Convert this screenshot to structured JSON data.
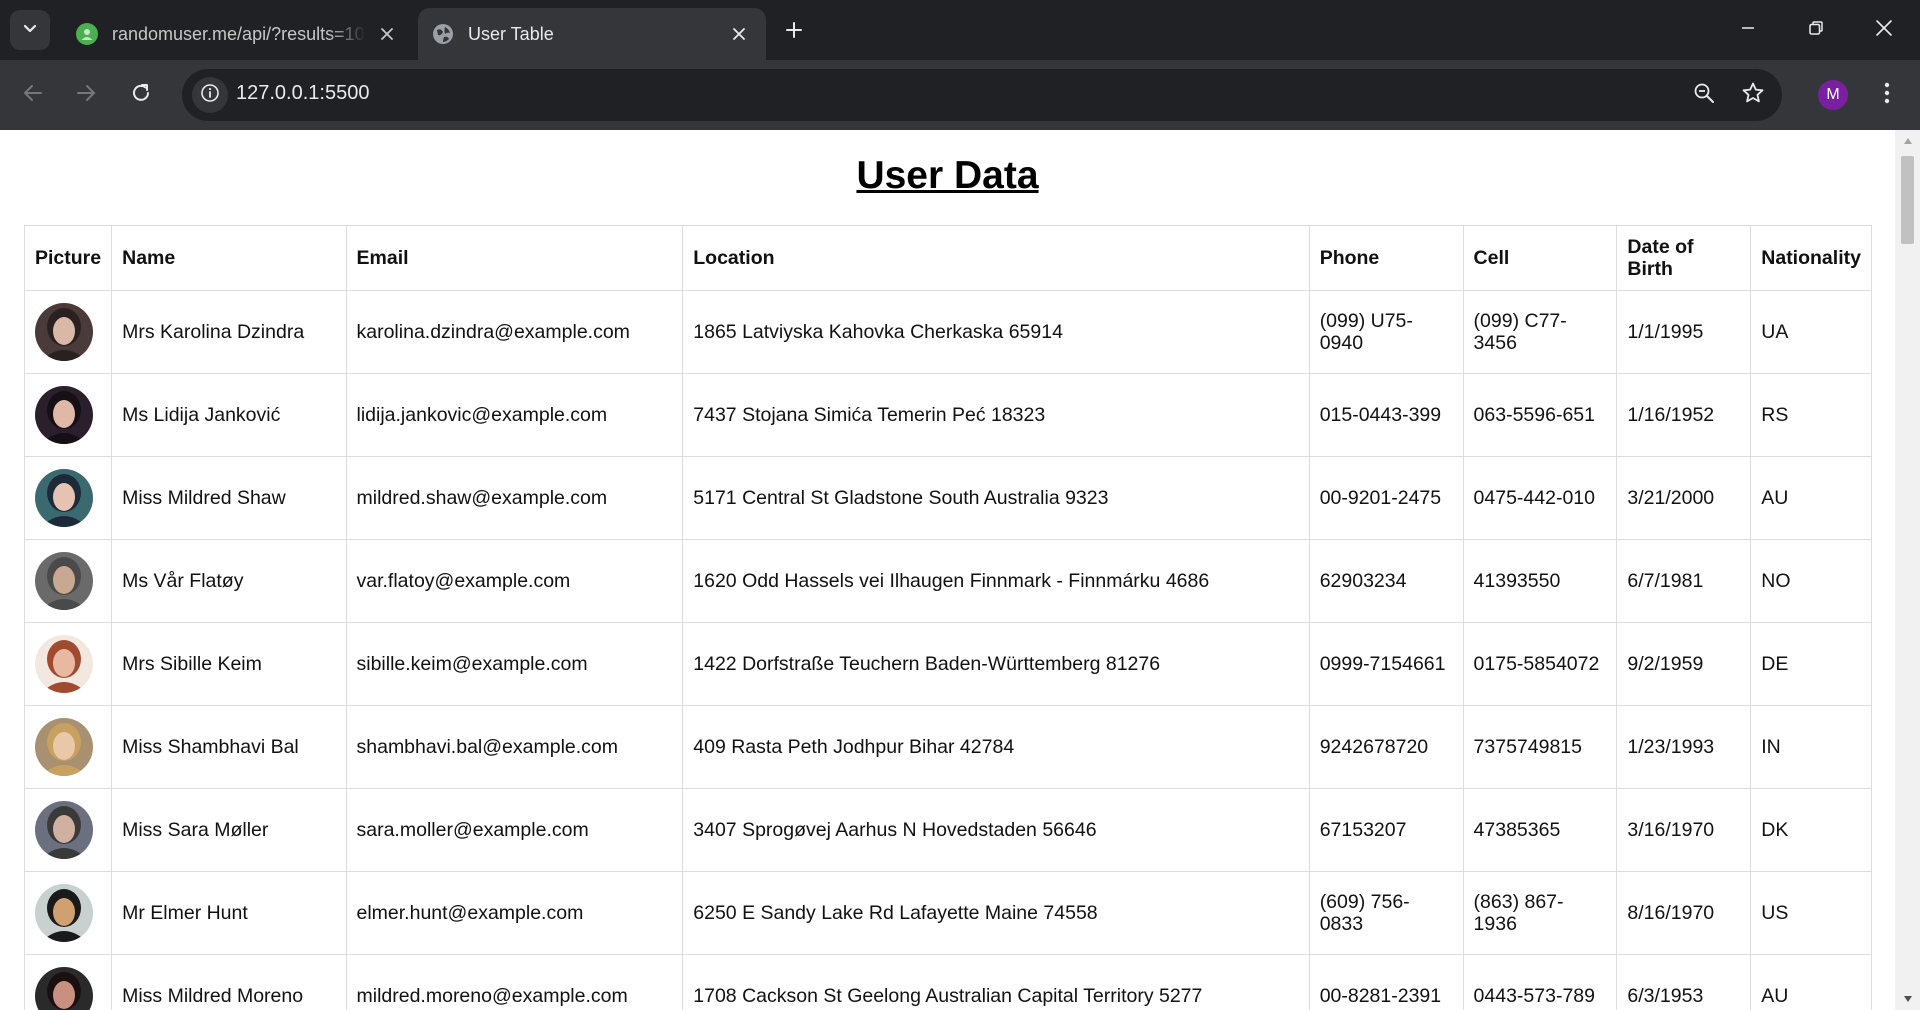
{
  "browser": {
    "tabs": [
      {
        "title": "randomuser.me/api/?results=10",
        "active": false
      },
      {
        "title": "User Table",
        "active": true
      }
    ],
    "address_bar": {
      "url": "127.0.0.1:5500"
    },
    "profile_initial": "M",
    "colors": {
      "tabstrip": "#202124",
      "toolbar": "#35363a",
      "favicon_randomuser": "#4caf50",
      "profile": "#7b1fa2"
    }
  },
  "page": {
    "title": "User Data",
    "table": {
      "headers": {
        "picture": "Picture",
        "name": "Name",
        "email": "Email",
        "location": "Location",
        "phone": "Phone",
        "cell": "Cell",
        "dob": "Date of Birth",
        "nationality": "Nationality"
      },
      "rows": [
        {
          "name": "Mrs Karolina Dzindra",
          "email": "karolina.dzindra@example.com",
          "location": "1865 Latviyska Kahovka Cherkaska 65914",
          "phone": "(099) U75-0940",
          "cell": "(099) C77-3456",
          "dob": "1/1/1995",
          "nat": "UA"
        },
        {
          "name": "Ms Lidija Janković",
          "email": "lidija.jankovic@example.com",
          "location": "7437 Stojana Simića Temerin Peć 18323",
          "phone": "015-0443-399",
          "cell": "063-5596-651",
          "dob": "1/16/1952",
          "nat": "RS"
        },
        {
          "name": "Miss Mildred Shaw",
          "email": "mildred.shaw@example.com",
          "location": "5171 Central St Gladstone South Australia 9323",
          "phone": "00-9201-2475",
          "cell": "0475-442-010",
          "dob": "3/21/2000",
          "nat": "AU"
        },
        {
          "name": "Ms Vår Flatøy",
          "email": "var.flatoy@example.com",
          "location": "1620 Odd Hassels vei Ilhaugen Finnmark - Finnmárku 4686",
          "phone": "62903234",
          "cell": "41393550",
          "dob": "6/7/1981",
          "nat": "NO"
        },
        {
          "name": "Mrs Sibille Keim",
          "email": "sibille.keim@example.com",
          "location": "1422 Dorfstraße Teuchern Baden-Württemberg 81276",
          "phone": "0999-7154661",
          "cell": "0175-5854072",
          "dob": "9/2/1959",
          "nat": "DE"
        },
        {
          "name": "Miss Shambhavi Bal",
          "email": "shambhavi.bal@example.com",
          "location": "409 Rasta Peth Jodhpur Bihar 42784",
          "phone": "9242678720",
          "cell": "7375749815",
          "dob": "1/23/1993",
          "nat": "IN"
        },
        {
          "name": "Miss Sara Møller",
          "email": "sara.moller@example.com",
          "location": "3407 Sprogøvej Aarhus N Hovedstaden 56646",
          "phone": "67153207",
          "cell": "47385365",
          "dob": "3/16/1970",
          "nat": "DK"
        },
        {
          "name": "Mr Elmer Hunt",
          "email": "elmer.hunt@example.com",
          "location": "6250 E Sandy Lake Rd Lafayette Maine 74558",
          "phone": "(609) 756-0833",
          "cell": "(863) 867-1936",
          "dob": "8/16/1970",
          "nat": "US"
        },
        {
          "name": "Miss Mildred Moreno",
          "email": "mildred.moreno@example.com",
          "location": "1708 Cackson St Geelong Australian Capital Territory 5277",
          "phone": "00-8281-2391",
          "cell": "0443-573-789",
          "dob": "6/3/1953",
          "nat": "AU"
        }
      ]
    }
  }
}
